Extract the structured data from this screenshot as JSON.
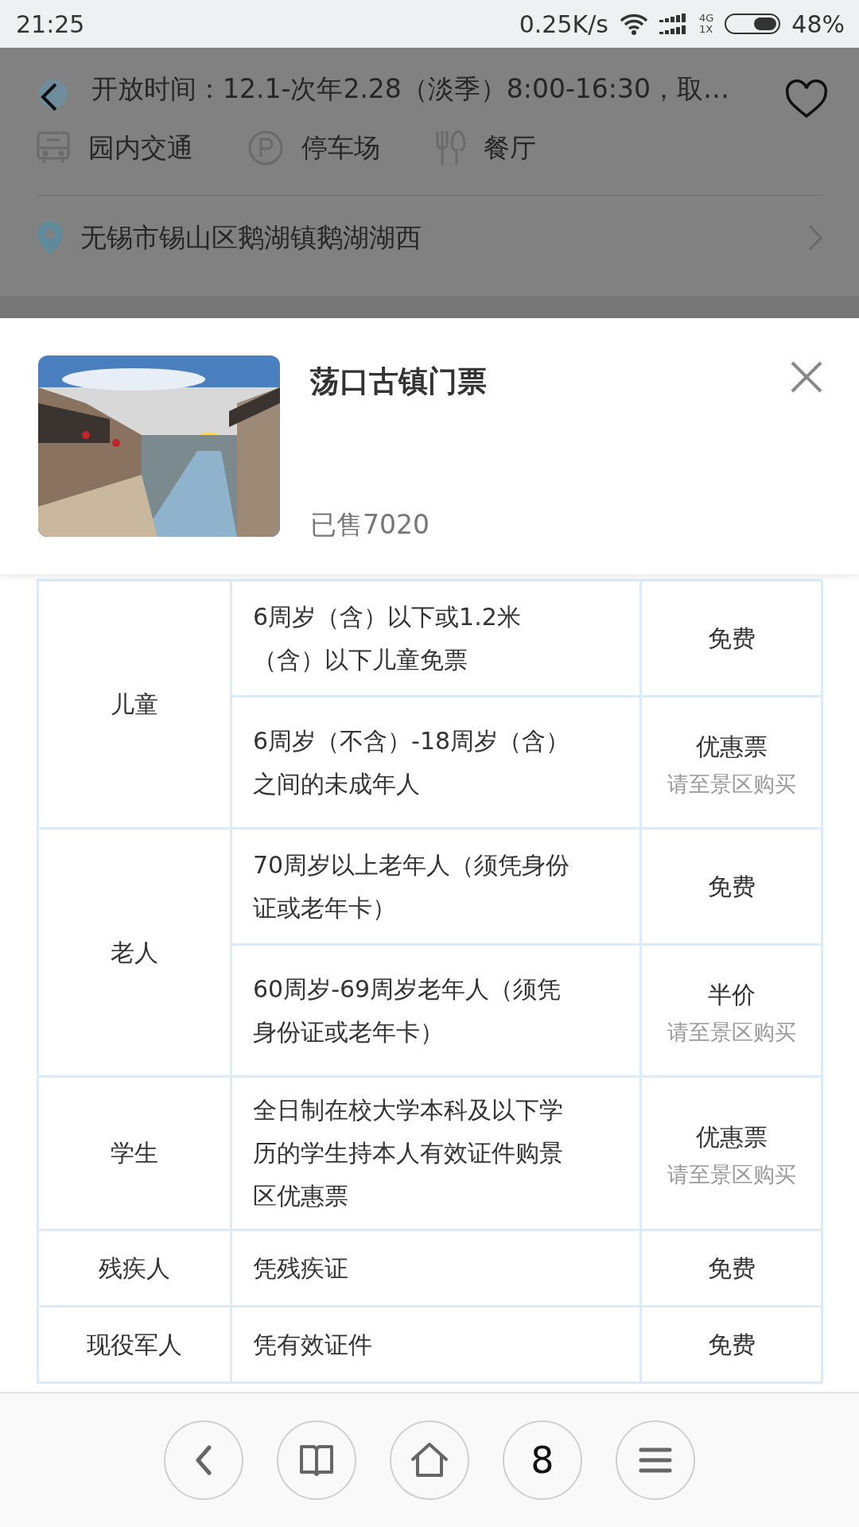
{
  "status_bar": {
    "time": "21:25",
    "speed": "0.25K/s",
    "network_top": "4G",
    "network_bottom": "1X",
    "battery": "48%"
  },
  "background_page": {
    "hours": "开放时间：12.1-次年2.28（淡季）8:00-16:30，取…",
    "facilities": [
      {
        "kind": "bus",
        "label": "园内交通"
      },
      {
        "kind": "parking",
        "label": "停车场"
      },
      {
        "kind": "restaurant",
        "label": "餐厅"
      }
    ],
    "address": "无锡市锡山区鹅湖镇鹅湖湖西"
  },
  "ticket": {
    "kind": "picture",
    "title": "荡口古镇门票",
    "sold": "已售7020"
  },
  "policy_table": [
    {
      "category": "儿童",
      "items": [
        {
          "condition": "6周岁（含）以下或1.2米（含）以下儿童免票",
          "price": "免费"
        },
        {
          "condition": "6周岁（不含）-18周岁（含）之间的未成年人",
          "price": "优惠票",
          "note": "请至景区购买"
        }
      ]
    },
    {
      "category": "老人",
      "items": [
        {
          "condition": "70周岁以上老年人（须凭身份证或老年卡）",
          "price": "免费"
        },
        {
          "condition": "60周岁-69周岁老年人（须凭身份证或老年卡）",
          "price": "半价",
          "note": "请至景区购买"
        }
      ]
    },
    {
      "category": "学生",
      "items": [
        {
          "condition": "全日制在校大学本科及以下学历的学生持本人有效证件购景区优惠票",
          "price": "优惠票",
          "note": "请至景区购买"
        }
      ]
    },
    {
      "category": "残疾人",
      "items": [
        {
          "condition": "凭残疾证",
          "price": "免费"
        }
      ]
    },
    {
      "category": "现役军人",
      "items": [
        {
          "condition": "凭有效证件",
          "price": "免费"
        }
      ]
    }
  ],
  "bottom_nav": [
    {
      "kind": "back"
    },
    {
      "kind": "bookmarks"
    },
    {
      "kind": "home"
    },
    {
      "kind": "tabs",
      "label": "8"
    },
    {
      "kind": "menu"
    }
  ]
}
